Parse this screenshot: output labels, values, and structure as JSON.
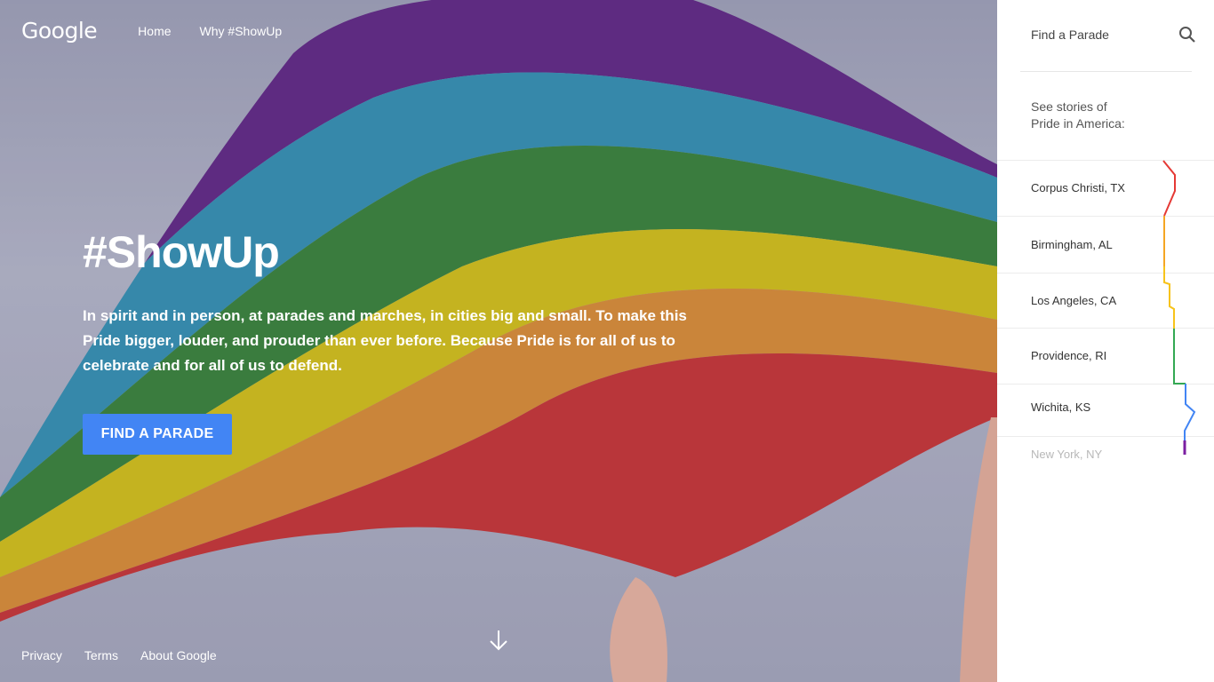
{
  "header": {
    "logo": "Google",
    "nav": [
      {
        "label": "Home"
      },
      {
        "label": "Why #ShowUp"
      }
    ]
  },
  "hero": {
    "title": "#ShowUp",
    "description": "In spirit and in person, at parades and marches, in cities big and small. To make this Pride bigger, louder, and prouder than ever before. Because Pride is for all of us to celebrate and for all of us to defend.",
    "cta_label": "FIND A PARADE"
  },
  "footer": {
    "links": [
      {
        "label": "Privacy"
      },
      {
        "label": "Terms"
      },
      {
        "label": "About Google"
      }
    ]
  },
  "sidebar": {
    "search_label": "Find a Parade",
    "intro_line1": "See stories of",
    "intro_line2": "Pride in America:",
    "cities": [
      {
        "label": "Corpus Christi, TX"
      },
      {
        "label": "Birmingham, AL"
      },
      {
        "label": "Los Angeles, CA"
      },
      {
        "label": "Providence, RI"
      },
      {
        "label": "Wichita, KS"
      },
      {
        "label": "New York, NY"
      }
    ]
  },
  "colors": {
    "accent": "#4285f4",
    "rainbow": [
      "#e53935",
      "#f5a623",
      "#f7c31b",
      "#34a853",
      "#4285f4",
      "#7b1fa2"
    ]
  }
}
